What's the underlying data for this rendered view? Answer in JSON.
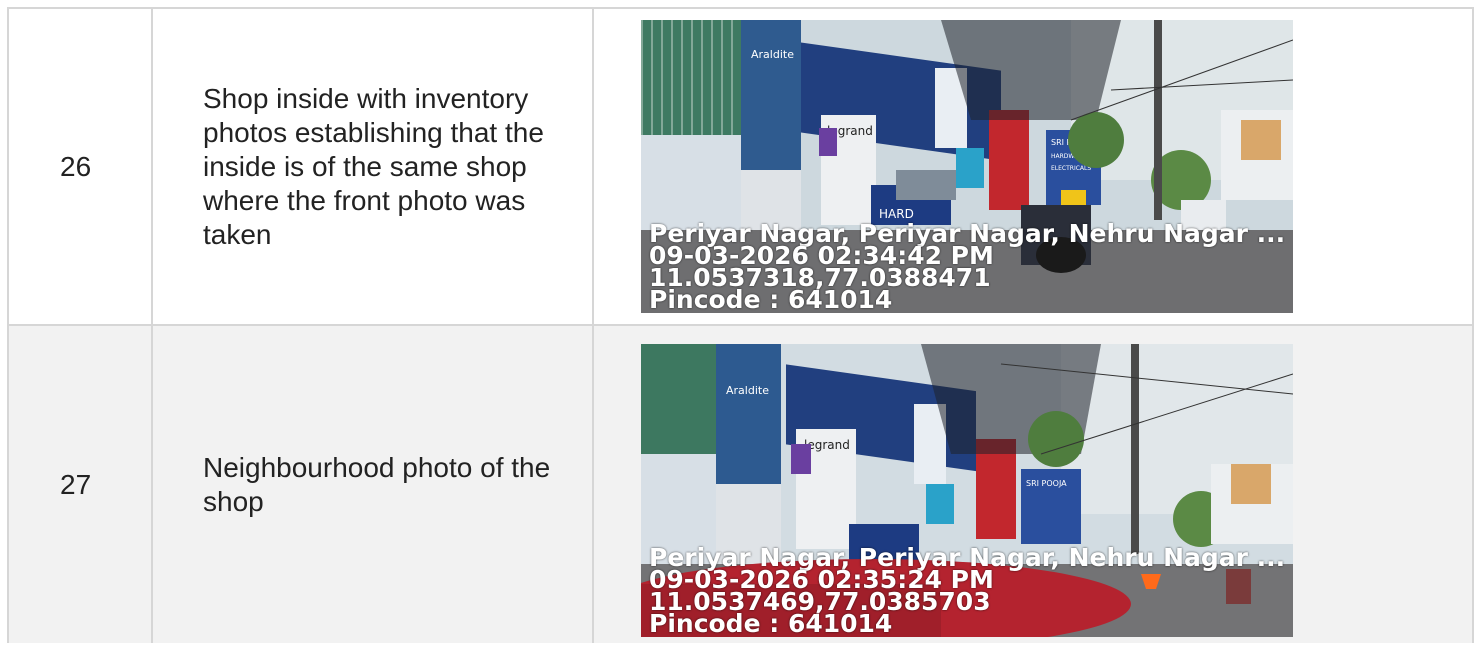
{
  "rows": [
    {
      "number": "26",
      "description": "Shop inside with inventory photos establishing that the inside is of the same shop where the front photo was taken",
      "photo": {
        "location": "Periyar Nagar, Periyar Nagar, Nehru Nagar ...",
        "datetime": "09-03-2026 02:34:42 PM",
        "coordinates": "11.0537318,77.0388471",
        "pincode": "Pincode : 641014"
      }
    },
    {
      "number": "27",
      "description": "Neighbourhood photo of the shop",
      "photo": {
        "location": "Periyar Nagar, Periyar Nagar, Nehru Nagar ...",
        "datetime": "09-03-2026 02:35:24 PM",
        "coordinates": "11.0537469,77.0385703",
        "pincode": "Pincode : 641014"
      }
    }
  ],
  "shop_signs": {
    "araldite": "Araldite",
    "legrand": "legrand",
    "hard": "HARD",
    "sri_pooja_1": "SRI POOJA",
    "sri_pooja_2": "HARDWARES",
    "sri_pooja_3": "ELECTRICALS"
  }
}
